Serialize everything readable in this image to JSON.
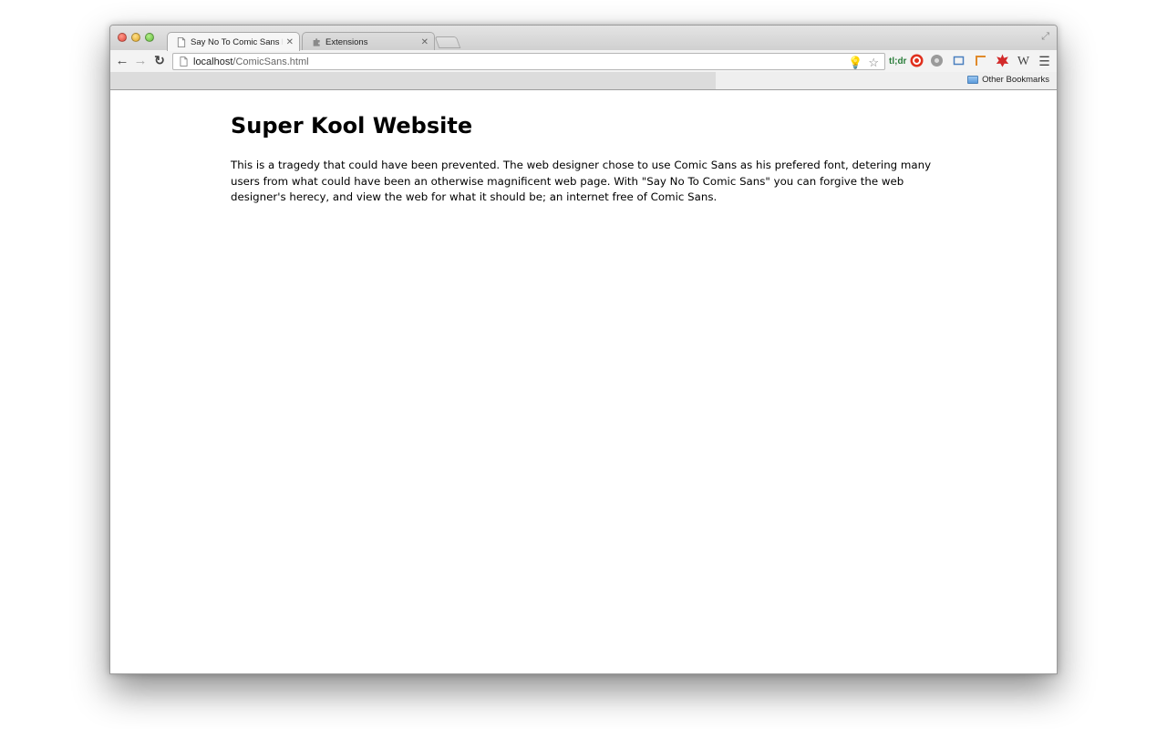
{
  "browser": {
    "tabs": [
      {
        "title": "Say No To Comic Sans Demo",
        "icon": "page-icon",
        "active": true
      },
      {
        "title": "Extensions",
        "icon": "puzzle-icon",
        "active": false
      }
    ],
    "address": {
      "host": "localhost",
      "path": "/ComicSans.html"
    },
    "bookmarks": {
      "other": "Other Bookmarks"
    },
    "extensions": [
      "tldr-icon",
      "stop-icon",
      "grey-extension-icon",
      "crop-icon",
      "ruler-icon",
      "red-badge-icon",
      "wikipedia-icon"
    ],
    "colors": {
      "tldr": "#2a7d3a",
      "stop": "#e0301e",
      "ruler": "#e08a2a",
      "badge": "#d22a2a"
    }
  },
  "page": {
    "heading": "Super Kool Website",
    "paragraph": "This is a tragedy that could have been prevented. The web designer chose to use Comic Sans as his prefered font, detering many users from what could have been an otherwise magnificent web page. With \"Say No To Comic Sans\" you can forgive the web designer's herecy, and view the web for what it should be; an internet free of Comic Sans."
  }
}
